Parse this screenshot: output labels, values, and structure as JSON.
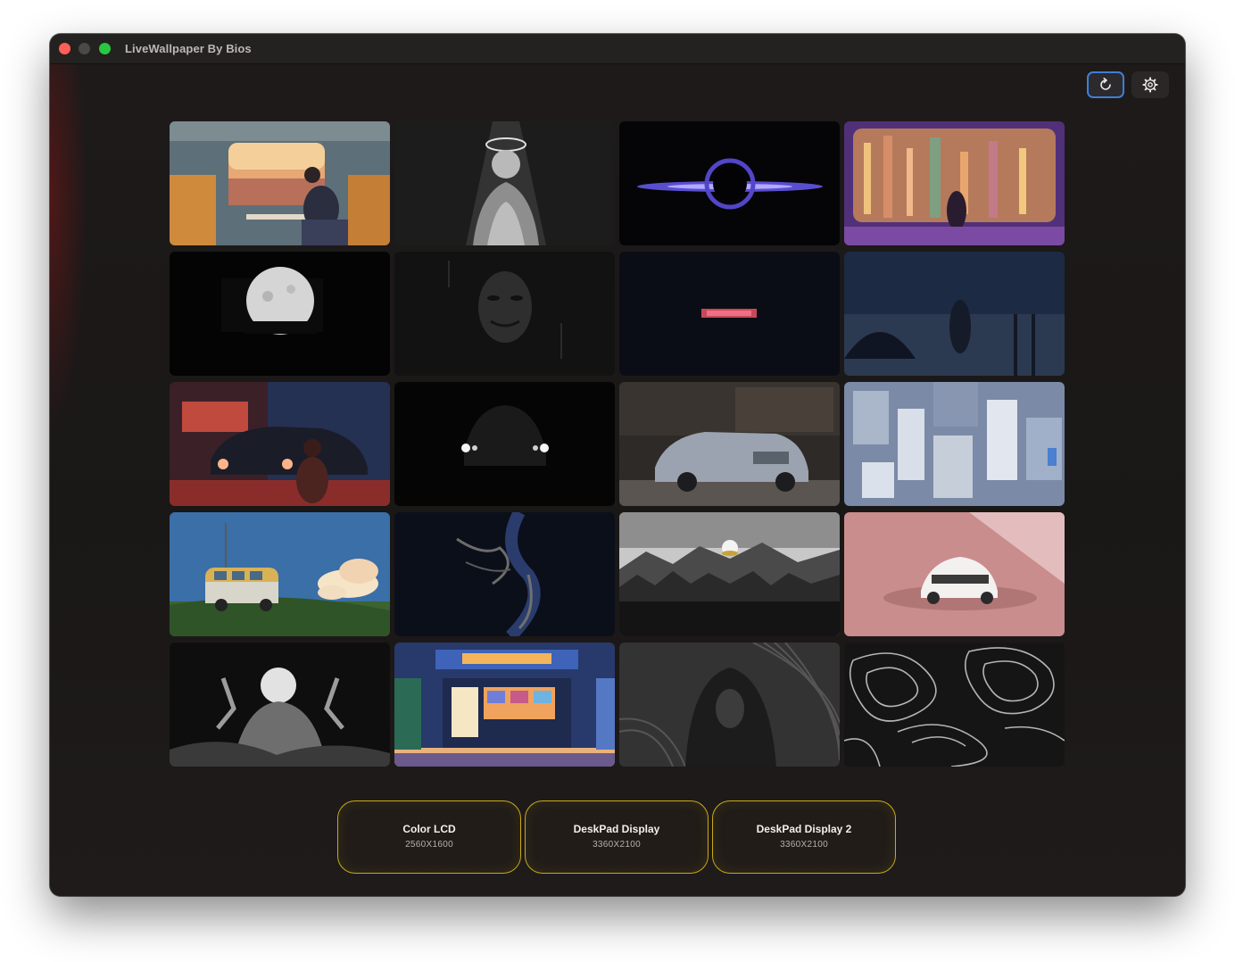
{
  "window": {
    "title": "LiveWallpaper By Bios"
  },
  "toolbar": {
    "refresh_icon": "refresh-icon",
    "settings_icon": "gear-icon"
  },
  "wallpapers": [
    {
      "scene": "anime girl on train at sunset"
    },
    {
      "scene": "angel statue with halo"
    },
    {
      "scene": "black hole with purple accretion disk"
    },
    {
      "scene": "cyberpunk city window"
    },
    {
      "scene": "full moon over trees"
    },
    {
      "scene": "masked face in dark"
    },
    {
      "scene": "red neon sign in dark"
    },
    {
      "scene": "girl by window at dusk"
    },
    {
      "scene": "girl sitting by car at night"
    },
    {
      "scene": "car headlights in dark"
    },
    {
      "scene": "silver sports car"
    },
    {
      "scene": "miniature city blocks"
    },
    {
      "scene": "van on hill with clouds"
    },
    {
      "scene": "dragon glow in dark"
    },
    {
      "scene": "mountain forest silhouette"
    },
    {
      "scene": "sports car on pink backdrop"
    },
    {
      "scene": "skull figure in dark"
    },
    {
      "scene": "anime shop at night"
    },
    {
      "scene": "hooded figure with stripes"
    },
    {
      "scene": "topographic line pattern"
    }
  ],
  "displays": [
    {
      "name": "Color LCD",
      "resolution": "2560X1600"
    },
    {
      "name": "DeskPad Display",
      "resolution": "3360X2100"
    },
    {
      "name": "DeskPad Display 2",
      "resolution": "3360X2100"
    }
  ],
  "colors": {
    "accent_selected_outline": "#c9a91a",
    "refresh_button_outline": "#3d7fd6"
  }
}
